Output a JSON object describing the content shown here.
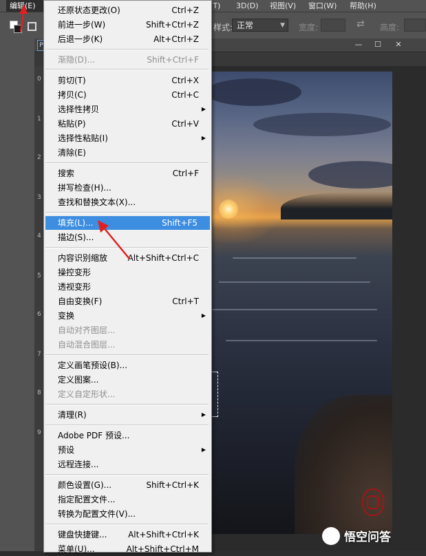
{
  "menubar": {
    "edit": "编辑(E)",
    "items": [
      "3D(D)",
      "视图(V)",
      "窗口(W)",
      "帮助(H)"
    ],
    "partial_left": "(T)"
  },
  "options": {
    "style_label": "样式:",
    "style_value": "正常",
    "width_label": "宽度:",
    "height_label": "高度:"
  },
  "document": {
    "tab_label": "P",
    "ruler_numbers": [
      "0",
      "1",
      "2",
      "3",
      "4",
      "5",
      "6",
      "7",
      "8",
      "9"
    ]
  },
  "watermark": "悟空问答",
  "menu": {
    "undo": {
      "label": "还原状态更改(O)",
      "shortcut": "Ctrl+Z"
    },
    "step_forward": {
      "label": "前进一步(W)",
      "shortcut": "Shift+Ctrl+Z"
    },
    "step_backward": {
      "label": "后退一步(K)",
      "shortcut": "Alt+Ctrl+Z"
    },
    "fade": {
      "label": "渐隐(D)...",
      "shortcut": "Shift+Ctrl+F"
    },
    "cut": {
      "label": "剪切(T)",
      "shortcut": "Ctrl+X"
    },
    "copy": {
      "label": "拷贝(C)",
      "shortcut": "Ctrl+C"
    },
    "copy_merged": {
      "label": "选择性拷贝"
    },
    "paste": {
      "label": "粘贴(P)",
      "shortcut": "Ctrl+V"
    },
    "paste_special": {
      "label": "选择性粘贴(I)"
    },
    "clear": {
      "label": "清除(E)"
    },
    "search": {
      "label": "搜索",
      "shortcut": "Ctrl+F"
    },
    "check_spelling": {
      "label": "拼写检查(H)..."
    },
    "find_replace": {
      "label": "查找和替换文本(X)..."
    },
    "fill": {
      "label": "填充(L)...",
      "shortcut": "Shift+F5"
    },
    "stroke": {
      "label": "描边(S)..."
    },
    "content_aware_scale": {
      "label": "内容识别缩放",
      "shortcut": "Alt+Shift+Ctrl+C"
    },
    "puppet_warp": {
      "label": "操控变形"
    },
    "perspective_warp": {
      "label": "透视变形"
    },
    "free_transform": {
      "label": "自由变换(F)",
      "shortcut": "Ctrl+T"
    },
    "transform": {
      "label": "变换"
    },
    "auto_align": {
      "label": "自动对齐图层..."
    },
    "auto_blend": {
      "label": "自动混合图层..."
    },
    "define_brush": {
      "label": "定义画笔预设(B)..."
    },
    "define_pattern": {
      "label": "定义图案..."
    },
    "define_shape": {
      "label": "定义自定形状..."
    },
    "purge": {
      "label": "清理(R)"
    },
    "adobe_pdf_presets": {
      "label": "Adobe PDF 预设..."
    },
    "presets": {
      "label": "预设"
    },
    "remote_connections": {
      "label": "远程连接..."
    },
    "color_settings": {
      "label": "颜色设置(G)...",
      "shortcut": "Shift+Ctrl+K"
    },
    "assign_profile": {
      "label": "指定配置文件..."
    },
    "convert_profile": {
      "label": "转换为配置文件(V)..."
    },
    "keyboard_shortcuts": {
      "label": "键盘快捷键...",
      "shortcut": "Alt+Shift+Ctrl+K"
    },
    "menus": {
      "label": "菜单(U)...",
      "shortcut": "Alt+Shift+Ctrl+M"
    }
  }
}
